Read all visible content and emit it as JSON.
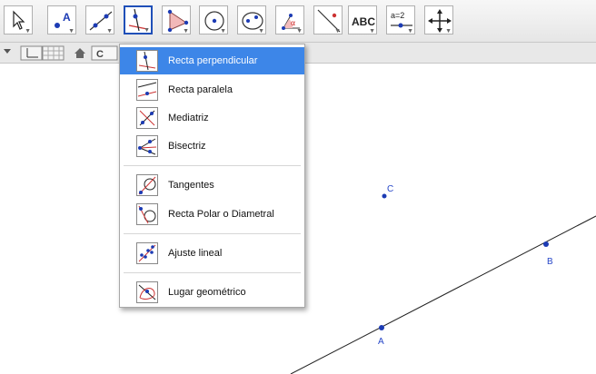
{
  "toolbar": {
    "tools": [
      {
        "name": "move-tool",
        "icon": "cursor-icon"
      },
      {
        "name": "point-tool",
        "icon": "point-icon",
        "label": "A"
      },
      {
        "name": "line-tool",
        "icon": "line-icon"
      },
      {
        "name": "perpendicular-line-tool",
        "icon": "perpendicular-icon",
        "active": true
      },
      {
        "name": "polygon-tool",
        "icon": "polygon-icon"
      },
      {
        "name": "circle-tool",
        "icon": "circle-icon"
      },
      {
        "name": "conic-tool",
        "icon": "ellipse-icon"
      },
      {
        "name": "angle-tool",
        "icon": "angle-icon",
        "label": "α"
      },
      {
        "name": "reflect-tool",
        "icon": "reflect-icon"
      },
      {
        "name": "text-tool",
        "icon": "text-icon",
        "label": "ABC"
      },
      {
        "name": "slider-tool",
        "icon": "slider-icon",
        "label": "a=2"
      },
      {
        "name": "move-view-tool",
        "icon": "move-view-icon"
      }
    ]
  },
  "subbar": {
    "style_button_label": "C"
  },
  "menu": {
    "items": [
      {
        "label": "Recta perpendicular",
        "icon": "perpendicular-icon",
        "selected": true
      },
      {
        "label": "Recta paralela",
        "icon": "parallel-icon"
      },
      {
        "label": "Mediatriz",
        "icon": "perpendicular-bisector-icon"
      },
      {
        "label": "Bisectriz",
        "icon": "angle-bisector-icon"
      },
      {
        "label": "Tangentes",
        "icon": "tangent-icon"
      },
      {
        "label": "Recta Polar o Diametral",
        "icon": "polar-line-icon"
      },
      {
        "label": "Ajuste lineal",
        "icon": "best-fit-line-icon"
      },
      {
        "label": "Lugar geométrico",
        "icon": "locus-icon"
      }
    ]
  },
  "canvas": {
    "points": [
      {
        "label": "A"
      },
      {
        "label": "B"
      },
      {
        "label": "C"
      }
    ]
  },
  "colors": {
    "point": "#1c3bb4",
    "line": "#222222",
    "menu_selected": "#3d86e8",
    "active_tool_border": "#1f4fb8"
  }
}
